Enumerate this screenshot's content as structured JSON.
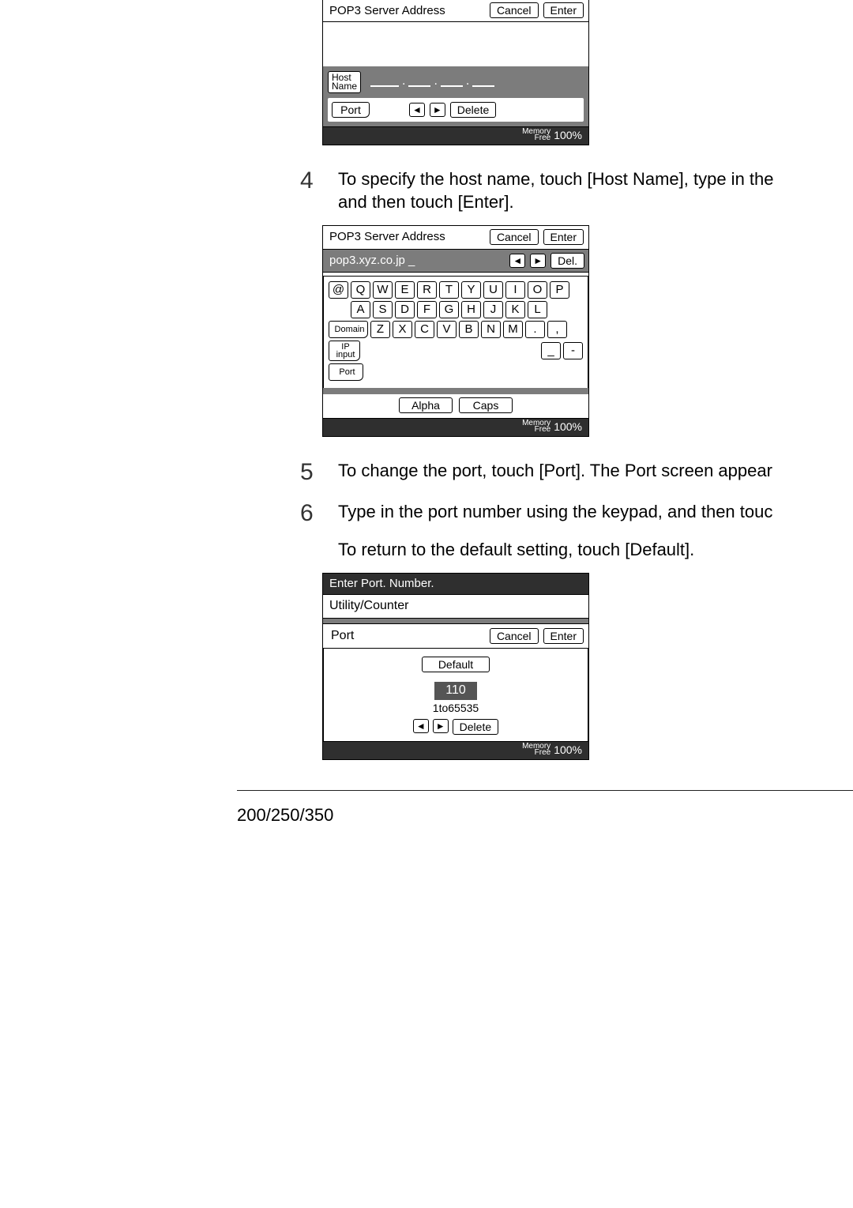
{
  "panel_top": {
    "title": "POP3 Server Address",
    "cancel": "Cancel",
    "enter": "Enter",
    "host_name_btn": "Host\nName",
    "port_btn": "Port",
    "delete_btn": "Delete",
    "memory_label1": "Memory",
    "memory_label2": "Free",
    "memory_pct": "100%"
  },
  "step4": {
    "num": "4",
    "text_l1": "To specify the host name, touch [Host Name], type in the",
    "text_l2": "and then touch [Enter]."
  },
  "panel_kbd": {
    "title": "POP3 Server Address",
    "cancel": "Cancel",
    "enter": "Enter",
    "input_value": "pop3.xyz.co.jp _",
    "del": "Del.",
    "row1": [
      "@",
      "Q",
      "W",
      "E",
      "R",
      "T",
      "Y",
      "U",
      "I",
      "O",
      "P"
    ],
    "row2": [
      "A",
      "S",
      "D",
      "F",
      "G",
      "H",
      "J",
      "K",
      "L"
    ],
    "domain": "Domain",
    "row3": [
      "Z",
      "X",
      "C",
      "V",
      "B",
      "N",
      "M",
      ".",
      ","
    ],
    "ip_input_l1": "IP",
    "ip_input_l2": "input",
    "underscore": "_",
    "dash": "-",
    "port": "Port",
    "alpha": "Alpha",
    "caps": "Caps",
    "memory_label1": "Memory",
    "memory_label2": "Free",
    "memory_pct": "100%"
  },
  "step5": {
    "num": "5",
    "text": "To change the port, touch [Port]. The Port screen appear"
  },
  "step6": {
    "num": "6",
    "text": "Type in the port number using the keypad, and then touc"
  },
  "step6b": {
    "text": "To return to the default setting, touch [Default]."
  },
  "panel_port": {
    "header": "Enter Port. Number.",
    "subheader": "Utility/Counter",
    "title": "Port",
    "cancel": "Cancel",
    "enter": "Enter",
    "default": "Default",
    "value": "110",
    "range": "1to65535",
    "delete": "Delete",
    "memory_label1": "Memory",
    "memory_label2": "Free",
    "memory_pct": "100%"
  },
  "model_line": "200/250/350"
}
